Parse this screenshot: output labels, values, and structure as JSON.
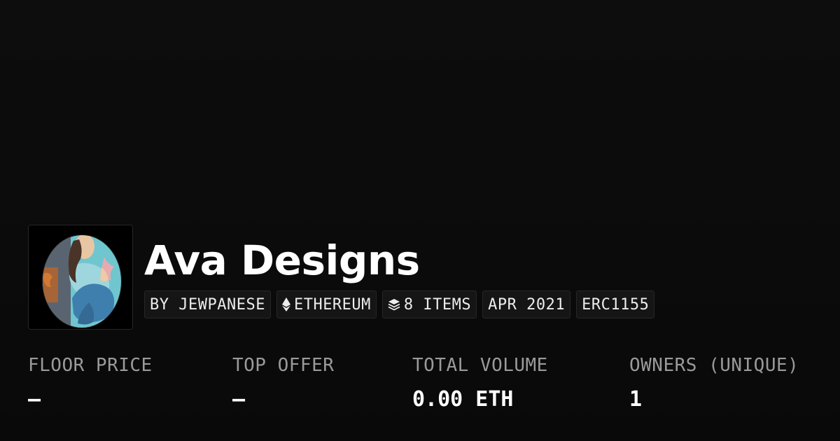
{
  "collection": {
    "name": "Ava Designs",
    "avatar_icon": "collection-avatar-illustration"
  },
  "badges": [
    {
      "label": "BY JEWPANESE",
      "icon": ""
    },
    {
      "label": "ETHEREUM",
      "icon": "ethereum-icon"
    },
    {
      "label": "8 ITEMS",
      "icon": "layers-icon"
    },
    {
      "label": "APR 2021",
      "icon": ""
    },
    {
      "label": "ERC1155",
      "icon": ""
    }
  ],
  "stats": [
    {
      "label": "FLOOR PRICE",
      "value": "—"
    },
    {
      "label": "TOP OFFER",
      "value": "—"
    },
    {
      "label": "TOTAL VOLUME",
      "value": "0.00 ETH"
    },
    {
      "label": "OWNERS (UNIQUE)",
      "value": "1"
    }
  ],
  "colors": {
    "background": "#0b0b0b",
    "badge_bg": "#151515",
    "badge_border": "#262626",
    "label_gray": "#9a9a9a",
    "text_white": "#ffffff"
  }
}
